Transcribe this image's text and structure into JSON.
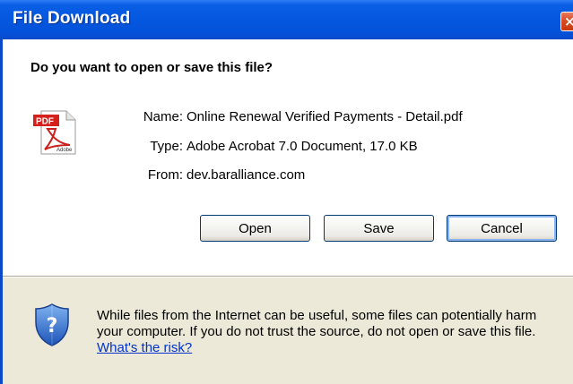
{
  "window": {
    "title": "File Download",
    "close_glyph": "×"
  },
  "dialog": {
    "question": "Do you want to open or save this file?",
    "file_icon": "pdf-file-icon",
    "info": {
      "name_label": "Name:",
      "name_value": "Online Renewal Verified Payments - Detail.pdf",
      "type_label": "Type:",
      "type_value": "Adobe Acrobat 7.0 Document, 17.0 KB",
      "from_label": "From:",
      "from_value": "dev.baralliance.com"
    },
    "buttons": {
      "open": "Open",
      "save": "Save",
      "cancel": "Cancel"
    },
    "warning": {
      "icon": "security-shield-icon",
      "text": "While files from the Internet can be useful, some files can potentially harm your computer. If you do not trust the source, do not open or save this file.",
      "link": "What's the risk?"
    }
  },
  "colors": {
    "titlebar": "#0457df",
    "dialog_bg": "#ece9d8",
    "link": "#0033cc"
  }
}
